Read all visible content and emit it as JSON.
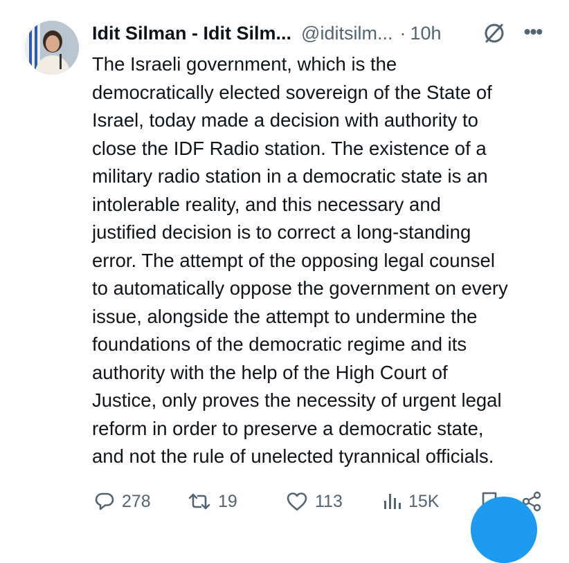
{
  "tweet": {
    "display_name": "Idit Silman - Idit Silm...",
    "handle": "@iditsilm...",
    "dot": "·",
    "time": "10h",
    "more": "•••",
    "body_lines": [
      "The Israeli government, which is the",
      "democratically elected sovereign of the State of",
      "Israel, today made a decision with authority to",
      "close the IDF Radio station. The existence of a",
      "military radio station in a democratic state is an",
      "intolerable reality, and this necessary and",
      "justified decision is to correct a long-standing",
      "error. The attempt of the opposing legal counsel",
      "to automatically oppose the government on every",
      "issue, alongside the attempt to undermine the",
      "foundations of the democratic regime and its",
      "authority with the help of the High Court of",
      "Justice, only proves the necessity of urgent legal",
      "reform in order to preserve a democratic state,",
      "and not the rule of unelected tyrannical officials."
    ],
    "actions": {
      "replies": "278",
      "retweets": "19",
      "likes": "113",
      "views": "15K"
    }
  },
  "colors": {
    "text": "#0f1419",
    "secondary": "#536471",
    "accent": "#1d9bf0"
  },
  "icons": {
    "blocked": "blocked-icon",
    "more": "more-icon",
    "reply": "reply-icon",
    "retweet": "retweet-icon",
    "like": "like-icon",
    "views": "views-icon",
    "bookmark": "bookmark-icon",
    "share": "share-icon"
  }
}
